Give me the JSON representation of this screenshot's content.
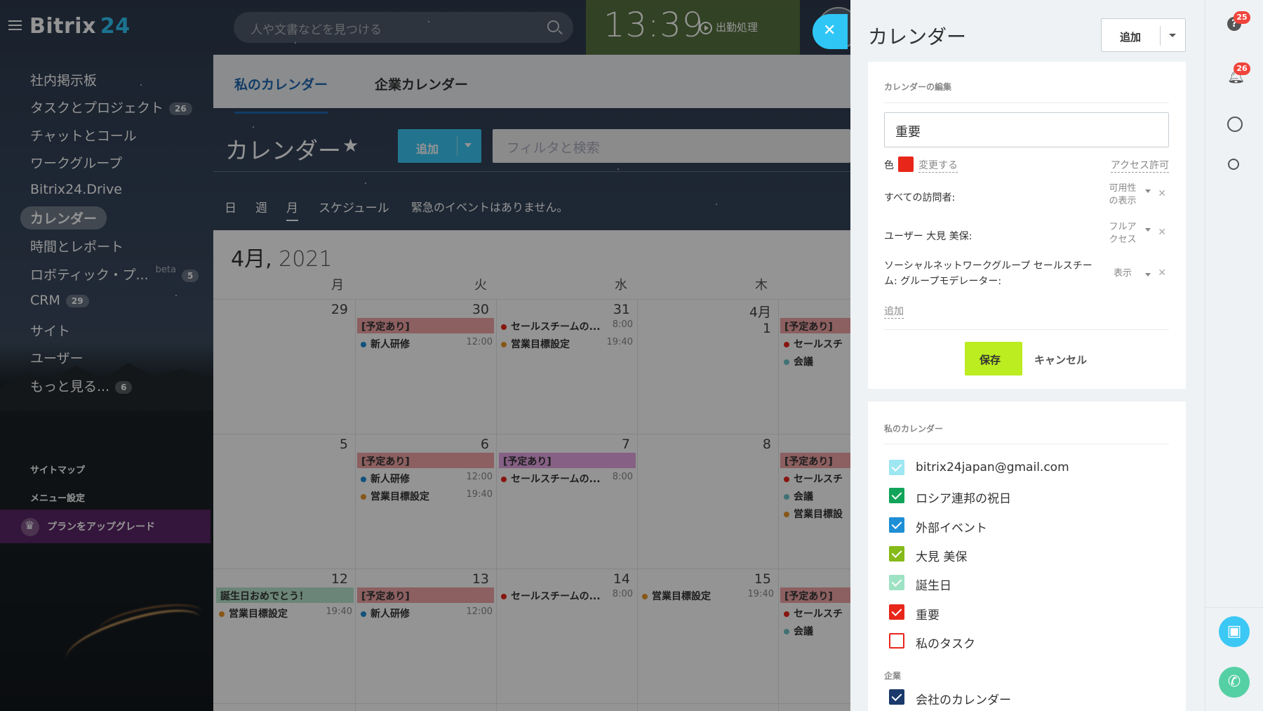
{
  "header": {
    "logo_text": "Bitrix",
    "logo_num": "24",
    "search_placeholder": "人や文書などを見つける",
    "clock": "13:39",
    "worktime_label": "出勤処理"
  },
  "menu": {
    "items": [
      {
        "label": "社内掲示板"
      },
      {
        "label": "タスクとプロジェクト",
        "counter": "26"
      },
      {
        "label": "チャットとコール"
      },
      {
        "label": "ワークグループ"
      },
      {
        "label": "Bitrix24.Drive"
      },
      {
        "label": "カレンダー"
      },
      {
        "label": "時間とレポート"
      },
      {
        "label": "ロボティック・プ...",
        "beta": "beta",
        "counter": "5"
      },
      {
        "label": "CRM",
        "counter": "29"
      },
      {
        "label": "サイト"
      },
      {
        "label": "ユーザー"
      },
      {
        "label": "もっと見る...",
        "counter": "6"
      }
    ],
    "sitemap": "サイトマップ",
    "menu_settings": "メニュー設定",
    "upgrade": "プランをアップグレード"
  },
  "main": {
    "tabs": [
      {
        "label": "私のカレンダー"
      },
      {
        "label": "企業カレンダー"
      }
    ],
    "title": "カレンダー",
    "add_label": "追加",
    "filter_placeholder": "フィルタと検索",
    "views": [
      {
        "label": "日"
      },
      {
        "label": "週"
      },
      {
        "label": "月"
      },
      {
        "label": "スケジュール"
      }
    ],
    "no_events": "緊急のイベントはありません。",
    "month": "4月,",
    "year": "2021",
    "weekdays": [
      "月",
      "火",
      "水",
      "木"
    ],
    "weeks": [
      {
        "days": [
          "29",
          "30",
          "31",
          "4月1"
        ]
      },
      {
        "days": [
          "5",
          "6",
          "7",
          "8"
        ]
      },
      {
        "days": [
          "12",
          "13",
          "14",
          "15"
        ]
      }
    ],
    "events": {
      "busy": "[予定あり]",
      "sales_team": "セールスチームの...",
      "sales_team_short": "セールスチ",
      "training": "新人研修",
      "sales_goal": "営業目標設定",
      "sales_goal_short": "営業目標設",
      "meeting": "会議",
      "birthday": "誕生日おめでとう！",
      "t800": "8:00",
      "t1200": "12:00",
      "t1940": "19:40"
    }
  },
  "panel": {
    "title": "カレンダー",
    "add_label": "追加",
    "edit_section": "カレンダーの編集",
    "name_value": "重要",
    "color_label": "色",
    "color_value": "#e8261a",
    "change_link": "変更する",
    "access_link": "アクセス許可",
    "access_rows": [
      {
        "name": "すべての訪問者:",
        "value_line1": "可用性",
        "value_line2": "の表示"
      },
      {
        "name": "ユーザー 大見 美保:",
        "value_line1": "フルア",
        "value_line2": "クセス"
      },
      {
        "name": "ソーシャルネットワークグループ セールスチーム: グループモデレーター:",
        "value_line1": "表示",
        "value_line2": ""
      }
    ],
    "add_access": "追加",
    "save": "保存",
    "cancel": "キャンセル",
    "my_calendars_section": "私のカレンダー",
    "calendars": [
      {
        "label": "bitrix24japan@gmail.com",
        "color": "#9ee6f2",
        "checked": true
      },
      {
        "label": "ロシア連邦の祝日",
        "color": "#12a45a",
        "checked": true
      },
      {
        "label": "外部イベント",
        "color": "#1e8fd6",
        "checked": true
      },
      {
        "label": "大見 美保",
        "color": "#86ba1a",
        "checked": true
      },
      {
        "label": "誕生日",
        "color": "#9ee2c4",
        "checked": true
      },
      {
        "label": "重要",
        "color": "#e8261a",
        "checked": true
      },
      {
        "label": "私のタスク",
        "color": "#e8261a",
        "checked": false
      }
    ],
    "company_section": "企業",
    "company_calendars": [
      {
        "label": "会社のカレンダー",
        "color": "#1b3a6b",
        "checked": true
      }
    ]
  },
  "rail": {
    "help_badge": "25",
    "notif_badge": "26"
  }
}
